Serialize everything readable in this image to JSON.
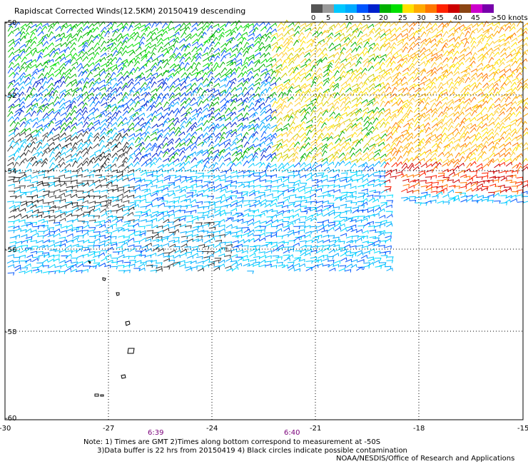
{
  "title": "Rapidscat Corrected Winds(12.5KM) 20150419 descending",
  "legend": {
    "colors": [
      "#555555",
      "#999999",
      "#00c8ff",
      "#00aaff",
      "#0055ff",
      "#0022cc",
      "#00b000",
      "#00e000",
      "#ffe000",
      "#ffaa00",
      "#ff7700",
      "#ff2200",
      "#cc0000",
      "#8b4513",
      "#cc00cc",
      "#7700aa"
    ],
    "labels": [
      "0",
      "5",
      "10",
      "15",
      "20",
      "25",
      "30",
      "35",
      "40",
      "45",
      ">50 knots"
    ]
  },
  "axes": {
    "lat_labels": [
      "-50",
      "-52",
      "-54",
      "-56",
      "-58",
      "-60"
    ],
    "lon_labels": [
      "-30",
      "-27",
      "-24",
      "-21",
      "-18",
      "-15"
    ]
  },
  "times": [
    "6:39",
    "6:40"
  ],
  "note": {
    "line1": "Note: 1) Times are GMT 2)Times along bottom correspond to measurement at -50S",
    "line2": "3)Data buffer is 22 hrs from 20150419 4) Black circles indicate possible contamination"
  },
  "credit": "NOAA/NESDIS/Office of Research and Applications"
}
